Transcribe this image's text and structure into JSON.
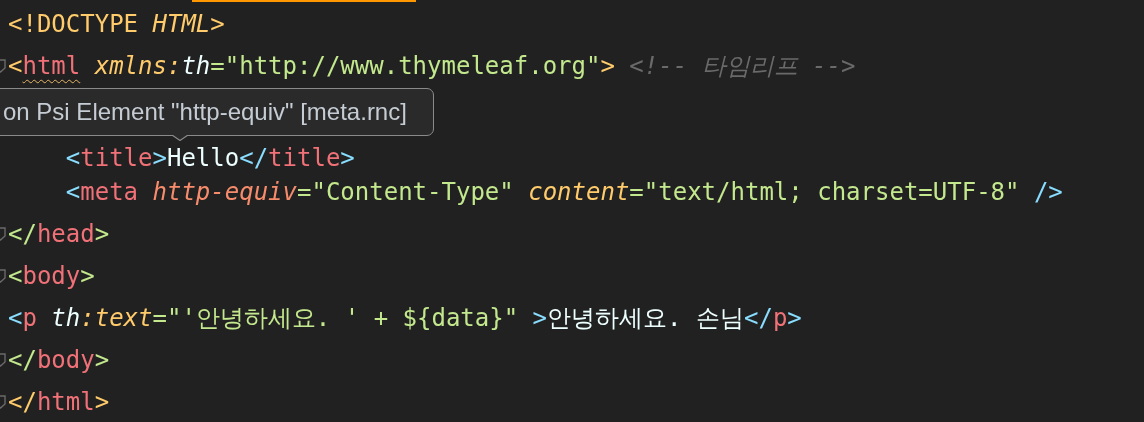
{
  "tooltip": {
    "text": "on Psi Element \"http-equiv\" [meta.rnc]"
  },
  "lines": [
    {
      "fold": false,
      "tokens": [
        {
          "text": "<!DOCTYPE ",
          "color": "#ffcb6b",
          "kind": "plain"
        },
        {
          "text": "HTML",
          "color": "#ffcb6b",
          "kind": "italic"
        },
        {
          "text": ">",
          "color": "#ffcb6b",
          "kind": "plain"
        }
      ]
    },
    {
      "fold": true,
      "tokens": [
        {
          "text": "<",
          "color": "#ffcb6b",
          "kind": "plain"
        },
        {
          "text": "html",
          "color": "#f07178",
          "kind": "squiggle"
        },
        {
          "text": " xmlns:",
          "color": "#ffcb6b",
          "kind": "italic"
        },
        {
          "text": "th",
          "color": "#eeffff",
          "kind": "italic"
        },
        {
          "text": "=\"http://www.thymeleaf.org\"",
          "color": "#c3e88d",
          "kind": "plain"
        },
        {
          "text": ">",
          "color": "#ffcb6b",
          "kind": "plain"
        },
        {
          "text": " <!-- 타임리프 -->",
          "color": "#6a6a6a",
          "kind": "italic"
        }
      ]
    },
    {
      "fold": false
    },
    {
      "fold": false,
      "tokens": [
        {
          "text": "    <",
          "color": "#89ddff",
          "kind": "plain"
        },
        {
          "text": "title",
          "color": "#f07178",
          "kind": "plain"
        },
        {
          "text": ">",
          "color": "#89ddff",
          "kind": "plain"
        },
        {
          "text": "Hello",
          "color": "#eeffff",
          "kind": "plain"
        },
        {
          "text": "</",
          "color": "#89ddff",
          "kind": "plain"
        },
        {
          "text": "title",
          "color": "#f07178",
          "kind": "plain"
        },
        {
          "text": ">",
          "color": "#89ddff",
          "kind": "plain"
        }
      ]
    },
    {
      "fold": false,
      "tokens": [
        {
          "text": "    <",
          "color": "#89ddff",
          "kind": "plain"
        },
        {
          "text": "meta",
          "color": "#f07178",
          "kind": "plain"
        },
        {
          "text": " http-equiv",
          "color": "#f78c6c",
          "kind": "italic"
        },
        {
          "text": "=\"Content-Type\" ",
          "color": "#c3e88d",
          "kind": "plain"
        },
        {
          "text": "content",
          "color": "#ffcb6b",
          "kind": "italic"
        },
        {
          "text": "=\"text/html; charset=UTF-8\" ",
          "color": "#c3e88d",
          "kind": "plain"
        },
        {
          "text": "/>",
          "color": "#89ddff",
          "kind": "plain"
        }
      ]
    },
    {
      "fold": true,
      "tokens": [
        {
          "text": "</",
          "color": "#c3e88d",
          "kind": "plain"
        },
        {
          "text": "head",
          "color": "#f07178",
          "kind": "plain"
        },
        {
          "text": ">",
          "color": "#c3e88d",
          "kind": "plain"
        }
      ]
    },
    {
      "fold": true,
      "tokens": [
        {
          "text": "<",
          "color": "#c3e88d",
          "kind": "plain"
        },
        {
          "text": "body",
          "color": "#f07178",
          "kind": "plain"
        },
        {
          "text": ">",
          "color": "#c3e88d",
          "kind": "plain"
        }
      ]
    },
    {
      "fold": false,
      "tokens": [
        {
          "text": "<",
          "color": "#89ddff",
          "kind": "plain"
        },
        {
          "text": "p",
          "color": "#f07178",
          "kind": "plain"
        },
        {
          "text": " th",
          "color": "#eeffff",
          "kind": "italic"
        },
        {
          "text": ":text",
          "color": "#ffcb6b",
          "kind": "italic"
        },
        {
          "text": "=\"'안녕하세요. ' + ${data}\" ",
          "color": "#c3e88d",
          "kind": "plain"
        },
        {
          "text": ">",
          "color": "#89ddff",
          "kind": "plain"
        },
        {
          "text": "안녕하세요. 손님",
          "color": "#eeffff",
          "kind": "plain"
        },
        {
          "text": "</",
          "color": "#89ddff",
          "kind": "plain"
        },
        {
          "text": "p",
          "color": "#f07178",
          "kind": "plain"
        },
        {
          "text": ">",
          "color": "#89ddff",
          "kind": "plain"
        }
      ]
    },
    {
      "fold": true,
      "tokens": [
        {
          "text": "</",
          "color": "#c3e88d",
          "kind": "plain"
        },
        {
          "text": "body",
          "color": "#f07178",
          "kind": "plain"
        },
        {
          "text": ">",
          "color": "#c3e88d",
          "kind": "plain"
        }
      ]
    },
    {
      "fold": true,
      "tokens": [
        {
          "text": "</",
          "color": "#ffcb6b",
          "kind": "plain"
        },
        {
          "text": "html",
          "color": "#f07178",
          "kind": "plain"
        },
        {
          "text": ">",
          "color": "#ffcb6b",
          "kind": "plain"
        }
      ]
    }
  ]
}
